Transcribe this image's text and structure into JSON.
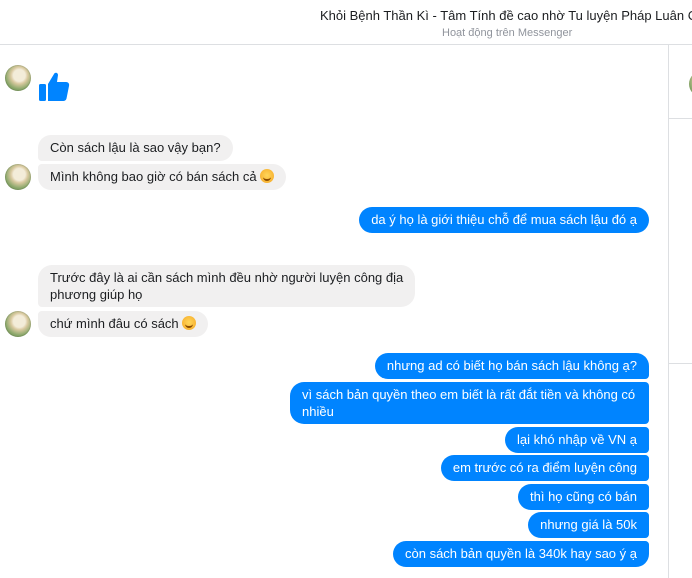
{
  "conversation": {
    "title": "Khỏi Bệnh Thần Kì - Tâm Tính đề cao nhờ Tu luyện Pháp Luân Công",
    "status": "Hoạt động trên Messenger"
  },
  "messages": [
    {
      "from": "them",
      "type": "like",
      "icon": "thumbs-up-icon"
    },
    {
      "from": "them",
      "text": "Còn sách lậu là sao vậy bạn?"
    },
    {
      "from": "them",
      "text": "Mình không bao giờ có bán sách cả",
      "emoji": "smiling-emoji"
    },
    {
      "from": "me",
      "text": "da ý họ là giới thiệu chỗ để mua sách lậu đó ạ"
    },
    {
      "from": "them",
      "line1": "Trước đây là ai cần sách mình đều nhờ người luyện công địa",
      "line2": "phương giúp họ"
    },
    {
      "from": "them",
      "text": "chứ mình đâu có sách",
      "emoji": "smiling-emoji"
    },
    {
      "from": "me",
      "text": "nhưng ad có biết họ bán sách lậu không ạ?"
    },
    {
      "from": "me",
      "line1": "vì sách bản quyền theo em biết là rất đắt tiền và không có",
      "line2": "nhiều"
    },
    {
      "from": "me",
      "text": "lại khó nhập về VN ạ"
    },
    {
      "from": "me",
      "text": "em trước có ra điểm luyện công"
    },
    {
      "from": "me",
      "text": "thì họ cũng có bán"
    },
    {
      "from": "me",
      "text": "nhưng giá là 50k"
    },
    {
      "from": "me",
      "text": "còn sách bản quyền là 340k hay sao ý ạ"
    }
  ],
  "colors": {
    "outgoing_bubble": "#0084ff",
    "incoming_bubble": "#f1f0f0",
    "like_icon": "#0084ff"
  }
}
